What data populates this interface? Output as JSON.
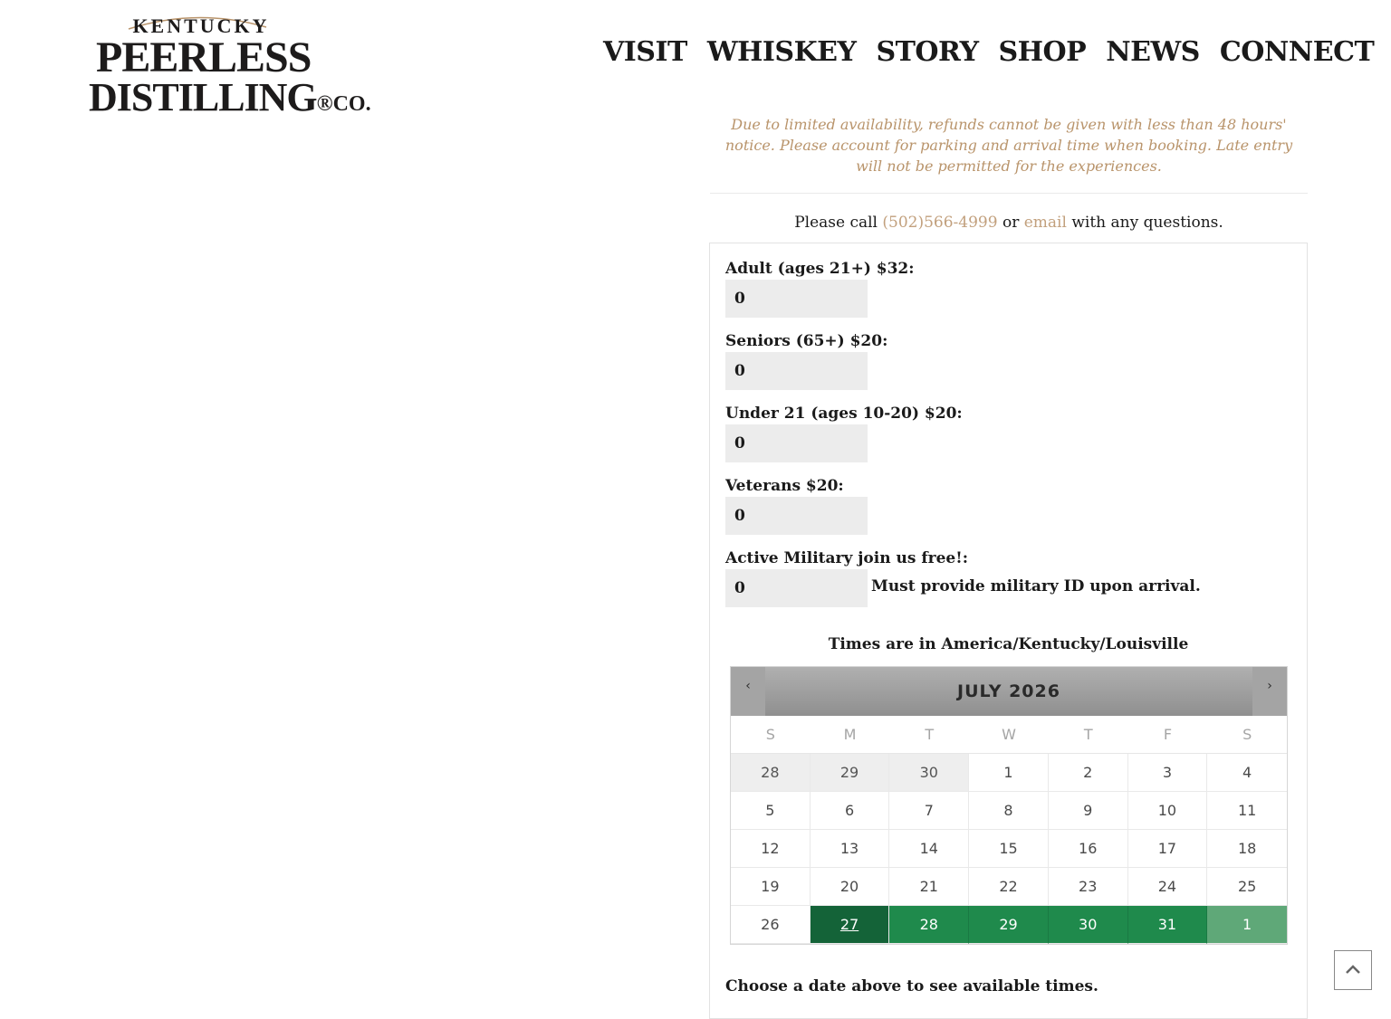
{
  "logo": {
    "line1": "KENTUCKY",
    "line2": "PEERLESS",
    "line3": "DISTILLING",
    "suffix": "®CO."
  },
  "nav": [
    "VISIT",
    "WHISKEY",
    "STORY",
    "SHOP",
    "NEWS",
    "CONNECT"
  ],
  "notice": "Due to limited availability, refunds cannot be given with less than 48 hours' notice. Please account for parking and arrival time when booking.  Late entry will not be permitted for the experiences.",
  "call": {
    "prefix": "Please call ",
    "phone": "(502)566-4999",
    "middle": " or ",
    "email": "email",
    "suffix": " with any questions."
  },
  "tickets": [
    {
      "label": "Adult (ages 21+) $32:",
      "value": "0"
    },
    {
      "label": "Seniors (65+) $20:",
      "value": "0"
    },
    {
      "label": "Under 21 (ages 10-20) $20:",
      "value": "0"
    },
    {
      "label": "Veterans $20:",
      "value": "0"
    },
    {
      "label": "Active Military join us free!:",
      "value": "0"
    }
  ],
  "military_note": "Must provide military ID upon arrival.",
  "timezone_note": "Times are in America/Kentucky/Louisville",
  "calendar": {
    "title": "JULY 2026",
    "prev": "‹",
    "next": "›",
    "weekdays": [
      "S",
      "M",
      "T",
      "W",
      "T",
      "F",
      "S"
    ],
    "days": [
      [
        "28",
        "29",
        "30",
        "1",
        "2",
        "3",
        "4"
      ],
      [
        "5",
        "6",
        "7",
        "8",
        "9",
        "10",
        "11"
      ],
      [
        "12",
        "13",
        "14",
        "15",
        "16",
        "17",
        "18"
      ],
      [
        "19",
        "20",
        "21",
        "22",
        "23",
        "24",
        "25"
      ],
      [
        "26",
        "27",
        "28",
        "29",
        "30",
        "31",
        "1"
      ]
    ]
  },
  "choose_note": "Choose a date above to see available times.",
  "colors": {
    "accent": "#b9946b",
    "available": "#1f8a4c",
    "selected": "#146338"
  }
}
